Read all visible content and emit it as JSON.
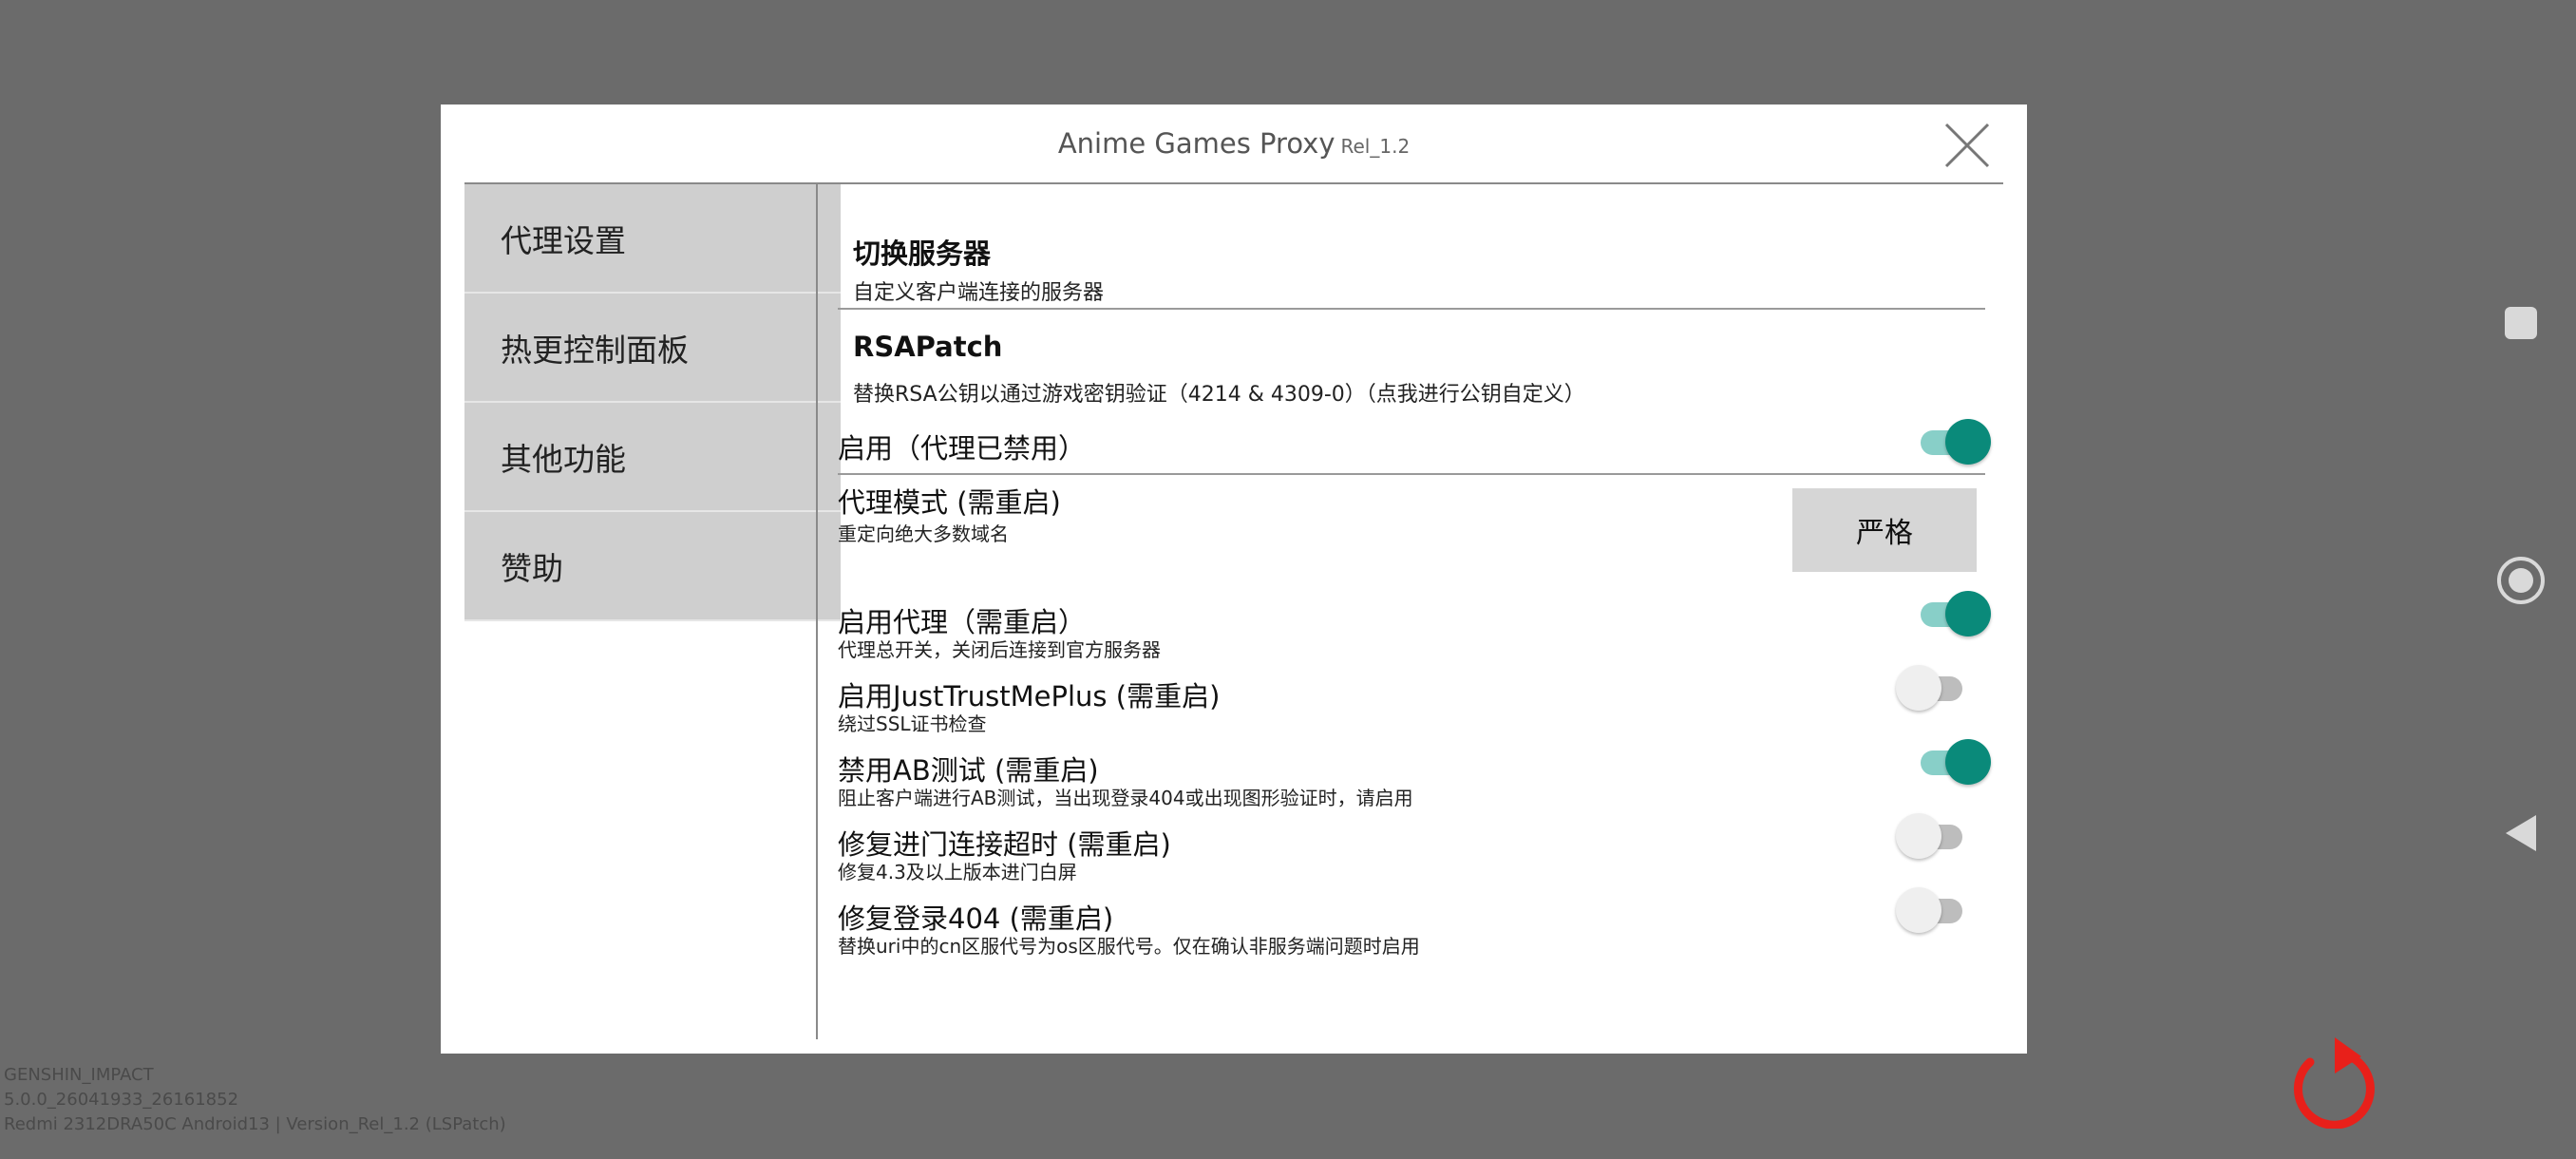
{
  "dialog": {
    "title": "Anime Games Proxy",
    "version": "Rel_1.2",
    "close_icon": "close-icon"
  },
  "sidebar": {
    "items": [
      {
        "label": "代理设置"
      },
      {
        "label": "热更控制面板"
      },
      {
        "label": "其他功能"
      },
      {
        "label": "赞助"
      }
    ]
  },
  "content": {
    "switch_server": {
      "title": "切换服务器",
      "subtitle": "自定义客户端连接的服务器"
    },
    "rsa_patch": {
      "title": "RSAPatch",
      "subtitle": "替换RSA公钥以通过游戏密钥验证（4214 & 4309-0）（点我进行公钥自定义）"
    },
    "enable_row": {
      "label": "启用（代理已禁用）",
      "on": true
    },
    "proxy_mode": {
      "label": "代理模式 (需重启)",
      "subtitle": "重定向绝大多数域名",
      "button": "严格"
    },
    "toggles": [
      {
        "label": "启用代理（需重启）",
        "subtitle": "代理总开关，关闭后连接到官方服务器",
        "on": true
      },
      {
        "label": "启用JustTrustMePlus (需重启)",
        "subtitle": "绕过SSL证书检查",
        "on": false
      },
      {
        "label": "禁用AB测试 (需重启)",
        "subtitle": "阻止客户端进行AB测试，当出现登录404或出现图形验证时，请启用",
        "on": true
      },
      {
        "label": "修复进门连接超时 (需重启)",
        "subtitle": "修复4.3及以上版本进门白屏",
        "on": false
      },
      {
        "label": "修复登录404 (需重启)",
        "subtitle": "替换uri中的cn区服代号为os区服代号。仅在确认非服务端问题时启用",
        "on": false
      }
    ]
  },
  "footer": {
    "line1": "GENSHIN_IMPACT",
    "line2": "5.0.0_26041933_26161852",
    "line3": "Redmi 2312DRA50C Android13 | Version_Rel_1.2 (LSPatch)"
  },
  "colors": {
    "accent": "#0a8a7a",
    "accent_track": "#88cfc8",
    "refresh": "#e8201a",
    "backdrop": "#6b6b6b"
  }
}
